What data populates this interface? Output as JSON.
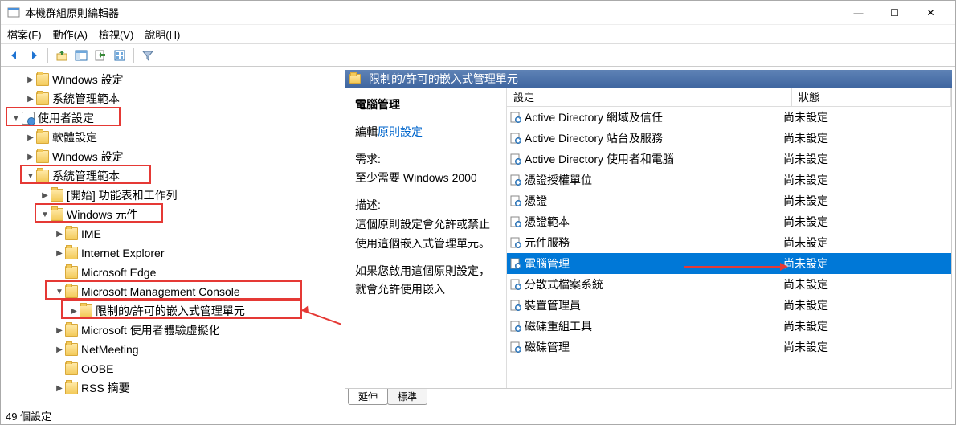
{
  "window": {
    "title": "本機群組原則編輯器"
  },
  "menu": {
    "file": "檔案(F)",
    "action": "動作(A)",
    "view": "檢視(V)",
    "help": "說明(H)"
  },
  "tree": {
    "n0": "Windows 設定",
    "n1": "系統管理範本",
    "n2": "使用者設定",
    "n3": "軟體設定",
    "n4": "Windows 設定",
    "n5": "系統管理範本",
    "n6": "[開始] 功能表和工作列",
    "n7": "Windows 元件",
    "n8": "IME",
    "n9": "Internet Explorer",
    "n10": "Microsoft Edge",
    "n11": "Microsoft Management Console",
    "n12": "限制的/許可的嵌入式管理單元",
    "n13": "Microsoft 使用者體驗虛擬化",
    "n14": "NetMeeting",
    "n15": "OOBE",
    "n16": "RSS 摘要"
  },
  "header": {
    "title": "限制的/許可的嵌入式管理單元"
  },
  "desc": {
    "title": "電腦管理",
    "edit_prefix": "編輯",
    "edit_link": "原則設定",
    "req_label": "需求:",
    "req_text": "至少需要 Windows 2000",
    "desc_label": "描述:",
    "desc_text": "這個原則設定會允許或禁止使用這個嵌入式管理單元。",
    "desc_text2": "如果您啟用這個原則設定，就會允許使用嵌入"
  },
  "cols": {
    "setting": "設定",
    "state": "狀態"
  },
  "rows": [
    {
      "name": "Active Directory 網域及信任",
      "state": "尚未設定"
    },
    {
      "name": "Active Directory 站台及服務",
      "state": "尚未設定"
    },
    {
      "name": "Active Directory 使用者和電腦",
      "state": "尚未設定"
    },
    {
      "name": "憑證授權單位",
      "state": "尚未設定"
    },
    {
      "name": "憑證",
      "state": "尚未設定"
    },
    {
      "name": "憑證範本",
      "state": "尚未設定"
    },
    {
      "name": "元件服務",
      "state": "尚未設定"
    },
    {
      "name": "電腦管理",
      "state": "尚未設定",
      "selected": true
    },
    {
      "name": "分散式檔案系統",
      "state": "尚未設定"
    },
    {
      "name": "裝置管理員",
      "state": "尚未設定"
    },
    {
      "name": "磁碟重組工具",
      "state": "尚未設定"
    },
    {
      "name": "磁碟管理",
      "state": "尚未設定"
    }
  ],
  "tabs": {
    "extended": "延伸",
    "standard": "標準"
  },
  "status": "49 個設定"
}
